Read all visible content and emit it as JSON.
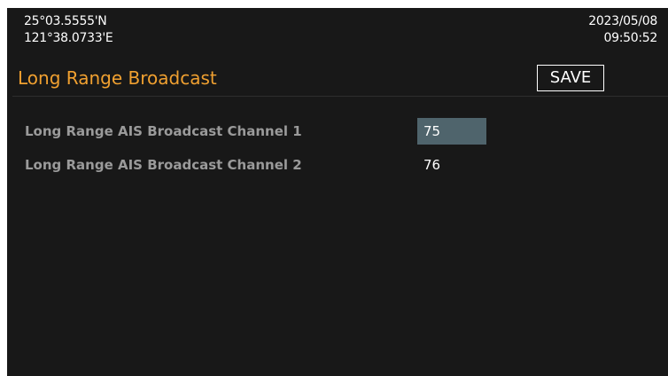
{
  "status": {
    "latitude": "25°03.5555'N",
    "longitude": "121°38.0733'E",
    "date": "2023/05/08",
    "time": "09:50:52"
  },
  "page": {
    "title": "Long Range Broadcast",
    "save_label": "SAVE"
  },
  "settings": [
    {
      "label": "Long Range AIS Broadcast Channel 1",
      "value": "75",
      "selected": true
    },
    {
      "label": "Long Range AIS Broadcast Channel 2",
      "value": "76",
      "selected": false
    }
  ],
  "colors": {
    "background": "#181818",
    "title": "#f0a030",
    "label": "#9a9a9a",
    "value": "#ffffff",
    "selection": "#4f646c"
  }
}
